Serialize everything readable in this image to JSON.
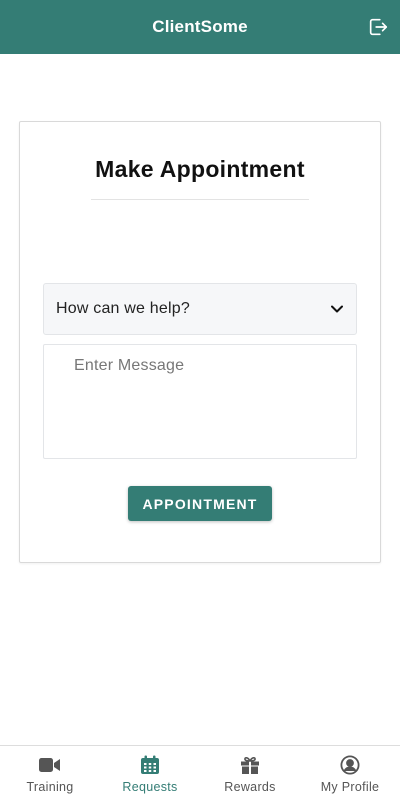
{
  "header": {
    "title": "ClientSome",
    "logout_icon": "logout-icon"
  },
  "form": {
    "title": "Make Appointment",
    "help_select": {
      "selected": "How can we help?",
      "icon": "chevron-down-icon"
    },
    "message": {
      "placeholder": "Enter Message",
      "value": ""
    },
    "submit_label": "APPOINTMENT"
  },
  "nav": {
    "items": [
      {
        "label": "Training",
        "icon": "video-camera-icon",
        "active": false
      },
      {
        "label": "Requests",
        "icon": "calendar-icon",
        "active": true
      },
      {
        "label": "Rewards",
        "icon": "gift-icon",
        "active": false
      },
      {
        "label": "My Profile",
        "icon": "user-circle-icon",
        "active": false
      }
    ]
  },
  "colors": {
    "primary": "#347d75",
    "inactive": "#555555",
    "background": "#ffffff"
  }
}
